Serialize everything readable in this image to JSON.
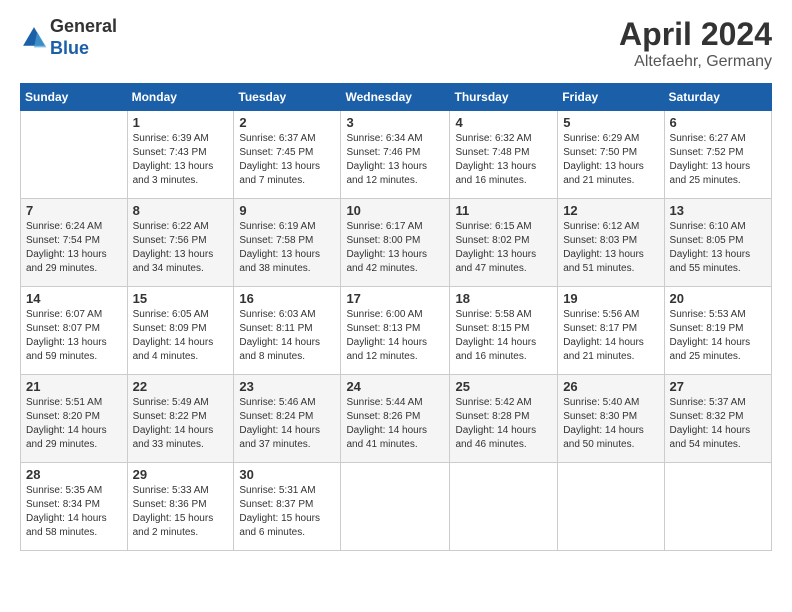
{
  "logo": {
    "general": "General",
    "blue": "Blue"
  },
  "header": {
    "month": "April 2024",
    "location": "Altefaehr, Germany"
  },
  "weekdays": [
    "Sunday",
    "Monday",
    "Tuesday",
    "Wednesday",
    "Thursday",
    "Friday",
    "Saturday"
  ],
  "weeks": [
    [
      {
        "day": "",
        "sunrise": "",
        "sunset": "",
        "daylight": ""
      },
      {
        "day": "1",
        "sunrise": "Sunrise: 6:39 AM",
        "sunset": "Sunset: 7:43 PM",
        "daylight": "Daylight: 13 hours and 3 minutes."
      },
      {
        "day": "2",
        "sunrise": "Sunrise: 6:37 AM",
        "sunset": "Sunset: 7:45 PM",
        "daylight": "Daylight: 13 hours and 7 minutes."
      },
      {
        "day": "3",
        "sunrise": "Sunrise: 6:34 AM",
        "sunset": "Sunset: 7:46 PM",
        "daylight": "Daylight: 13 hours and 12 minutes."
      },
      {
        "day": "4",
        "sunrise": "Sunrise: 6:32 AM",
        "sunset": "Sunset: 7:48 PM",
        "daylight": "Daylight: 13 hours and 16 minutes."
      },
      {
        "day": "5",
        "sunrise": "Sunrise: 6:29 AM",
        "sunset": "Sunset: 7:50 PM",
        "daylight": "Daylight: 13 hours and 21 minutes."
      },
      {
        "day": "6",
        "sunrise": "Sunrise: 6:27 AM",
        "sunset": "Sunset: 7:52 PM",
        "daylight": "Daylight: 13 hours and 25 minutes."
      }
    ],
    [
      {
        "day": "7",
        "sunrise": "Sunrise: 6:24 AM",
        "sunset": "Sunset: 7:54 PM",
        "daylight": "Daylight: 13 hours and 29 minutes."
      },
      {
        "day": "8",
        "sunrise": "Sunrise: 6:22 AM",
        "sunset": "Sunset: 7:56 PM",
        "daylight": "Daylight: 13 hours and 34 minutes."
      },
      {
        "day": "9",
        "sunrise": "Sunrise: 6:19 AM",
        "sunset": "Sunset: 7:58 PM",
        "daylight": "Daylight: 13 hours and 38 minutes."
      },
      {
        "day": "10",
        "sunrise": "Sunrise: 6:17 AM",
        "sunset": "Sunset: 8:00 PM",
        "daylight": "Daylight: 13 hours and 42 minutes."
      },
      {
        "day": "11",
        "sunrise": "Sunrise: 6:15 AM",
        "sunset": "Sunset: 8:02 PM",
        "daylight": "Daylight: 13 hours and 47 minutes."
      },
      {
        "day": "12",
        "sunrise": "Sunrise: 6:12 AM",
        "sunset": "Sunset: 8:03 PM",
        "daylight": "Daylight: 13 hours and 51 minutes."
      },
      {
        "day": "13",
        "sunrise": "Sunrise: 6:10 AM",
        "sunset": "Sunset: 8:05 PM",
        "daylight": "Daylight: 13 hours and 55 minutes."
      }
    ],
    [
      {
        "day": "14",
        "sunrise": "Sunrise: 6:07 AM",
        "sunset": "Sunset: 8:07 PM",
        "daylight": "Daylight: 13 hours and 59 minutes."
      },
      {
        "day": "15",
        "sunrise": "Sunrise: 6:05 AM",
        "sunset": "Sunset: 8:09 PM",
        "daylight": "Daylight: 14 hours and 4 minutes."
      },
      {
        "day": "16",
        "sunrise": "Sunrise: 6:03 AM",
        "sunset": "Sunset: 8:11 PM",
        "daylight": "Daylight: 14 hours and 8 minutes."
      },
      {
        "day": "17",
        "sunrise": "Sunrise: 6:00 AM",
        "sunset": "Sunset: 8:13 PM",
        "daylight": "Daylight: 14 hours and 12 minutes."
      },
      {
        "day": "18",
        "sunrise": "Sunrise: 5:58 AM",
        "sunset": "Sunset: 8:15 PM",
        "daylight": "Daylight: 14 hours and 16 minutes."
      },
      {
        "day": "19",
        "sunrise": "Sunrise: 5:56 AM",
        "sunset": "Sunset: 8:17 PM",
        "daylight": "Daylight: 14 hours and 21 minutes."
      },
      {
        "day": "20",
        "sunrise": "Sunrise: 5:53 AM",
        "sunset": "Sunset: 8:19 PM",
        "daylight": "Daylight: 14 hours and 25 minutes."
      }
    ],
    [
      {
        "day": "21",
        "sunrise": "Sunrise: 5:51 AM",
        "sunset": "Sunset: 8:20 PM",
        "daylight": "Daylight: 14 hours and 29 minutes."
      },
      {
        "day": "22",
        "sunrise": "Sunrise: 5:49 AM",
        "sunset": "Sunset: 8:22 PM",
        "daylight": "Daylight: 14 hours and 33 minutes."
      },
      {
        "day": "23",
        "sunrise": "Sunrise: 5:46 AM",
        "sunset": "Sunset: 8:24 PM",
        "daylight": "Daylight: 14 hours and 37 minutes."
      },
      {
        "day": "24",
        "sunrise": "Sunrise: 5:44 AM",
        "sunset": "Sunset: 8:26 PM",
        "daylight": "Daylight: 14 hours and 41 minutes."
      },
      {
        "day": "25",
        "sunrise": "Sunrise: 5:42 AM",
        "sunset": "Sunset: 8:28 PM",
        "daylight": "Daylight: 14 hours and 46 minutes."
      },
      {
        "day": "26",
        "sunrise": "Sunrise: 5:40 AM",
        "sunset": "Sunset: 8:30 PM",
        "daylight": "Daylight: 14 hours and 50 minutes."
      },
      {
        "day": "27",
        "sunrise": "Sunrise: 5:37 AM",
        "sunset": "Sunset: 8:32 PM",
        "daylight": "Daylight: 14 hours and 54 minutes."
      }
    ],
    [
      {
        "day": "28",
        "sunrise": "Sunrise: 5:35 AM",
        "sunset": "Sunset: 8:34 PM",
        "daylight": "Daylight: 14 hours and 58 minutes."
      },
      {
        "day": "29",
        "sunrise": "Sunrise: 5:33 AM",
        "sunset": "Sunset: 8:36 PM",
        "daylight": "Daylight: 15 hours and 2 minutes."
      },
      {
        "day": "30",
        "sunrise": "Sunrise: 5:31 AM",
        "sunset": "Sunset: 8:37 PM",
        "daylight": "Daylight: 15 hours and 6 minutes."
      },
      {
        "day": "",
        "sunrise": "",
        "sunset": "",
        "daylight": ""
      },
      {
        "day": "",
        "sunrise": "",
        "sunset": "",
        "daylight": ""
      },
      {
        "day": "",
        "sunrise": "",
        "sunset": "",
        "daylight": ""
      },
      {
        "day": "",
        "sunrise": "",
        "sunset": "",
        "daylight": ""
      }
    ]
  ]
}
